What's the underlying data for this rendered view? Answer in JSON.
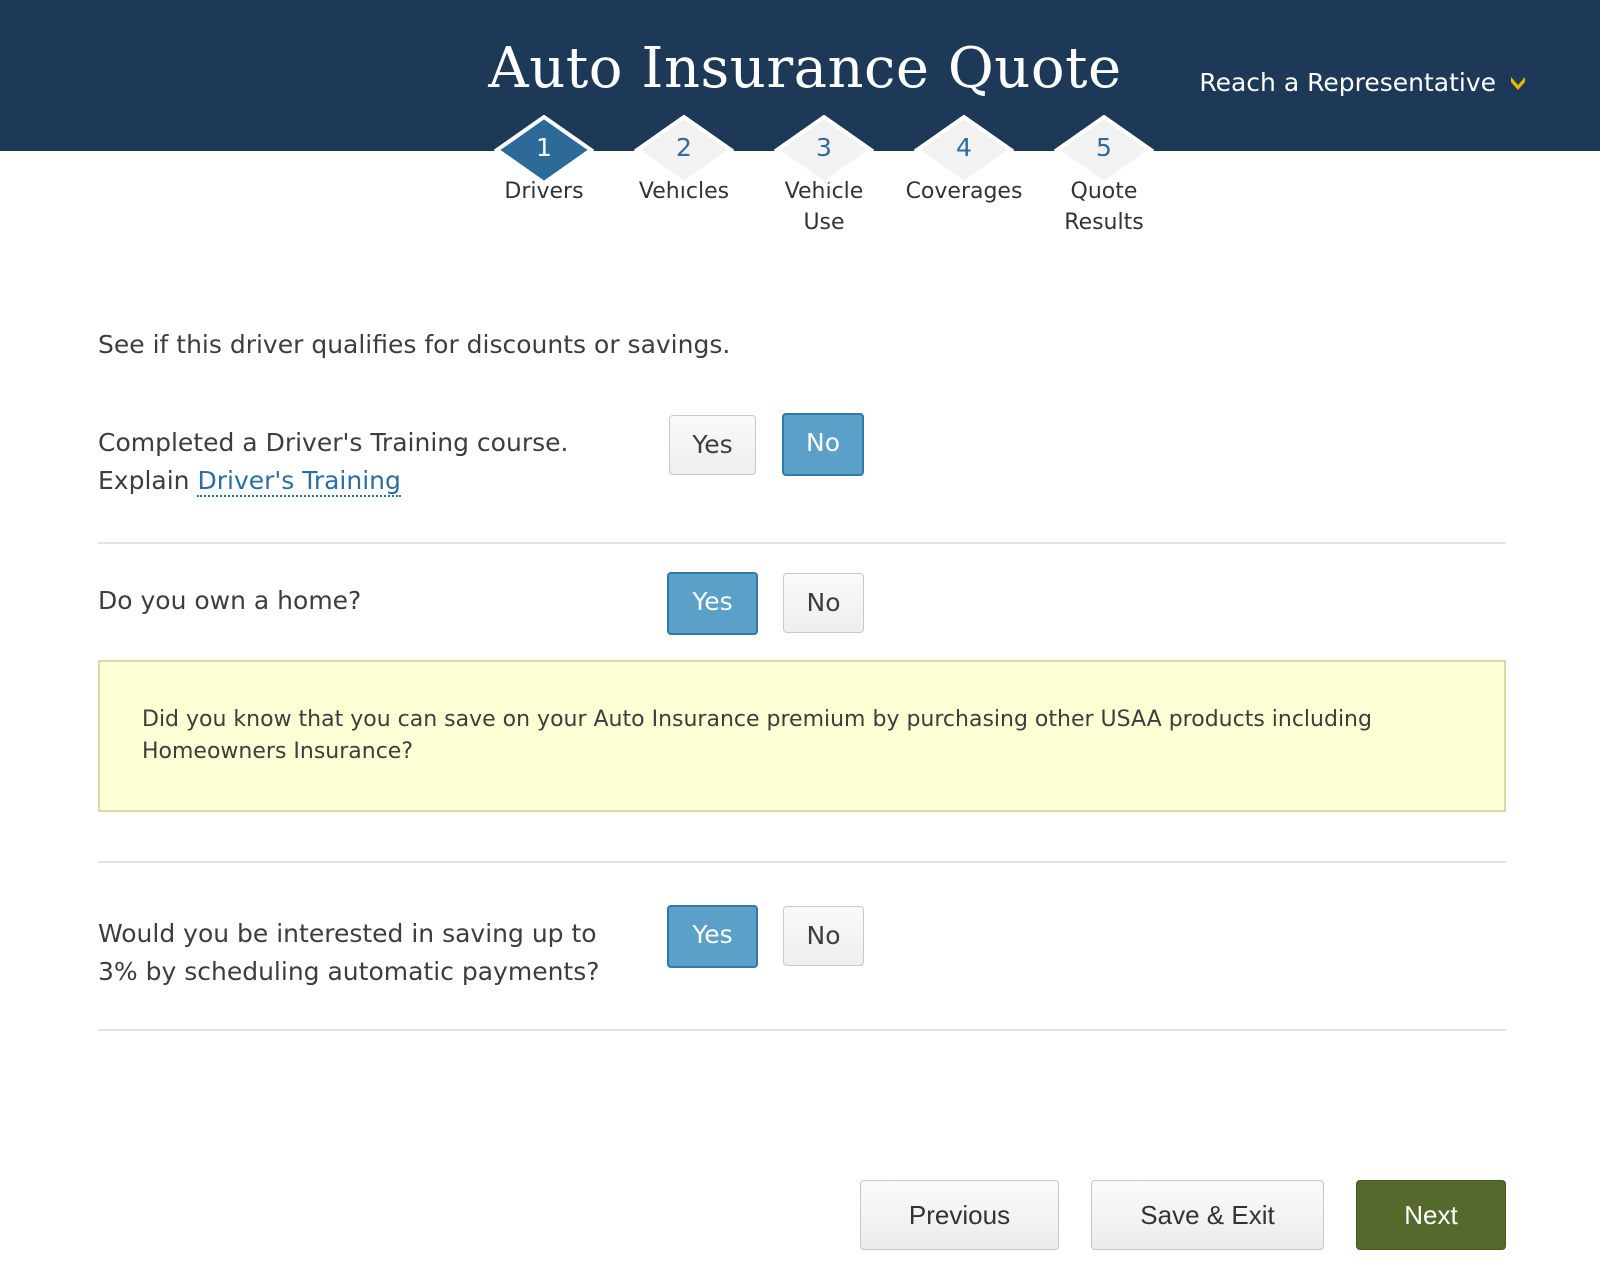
{
  "header": {
    "title": "Auto Insurance Quote",
    "rep_link": "Reach a Representative",
    "accent_color": "#e6b800",
    "bg_color": "#1e3957"
  },
  "steps": [
    {
      "num": "1",
      "line1": "Drivers",
      "line2": "",
      "active": true
    },
    {
      "num": "2",
      "line1": "Vehicles",
      "line2": "",
      "active": false
    },
    {
      "num": "3",
      "line1": "Vehicle",
      "line2": "Use",
      "active": false
    },
    {
      "num": "4",
      "line1": "Coverages",
      "line2": "",
      "active": false
    },
    {
      "num": "5",
      "line1": "Quote",
      "line2": "Results",
      "active": false
    }
  ],
  "intro": "See if this driver qualifies for discounts or savings.",
  "questions": {
    "training": {
      "line1": "Completed a Driver's Training course.",
      "explain_prefix": "Explain ",
      "explain_link": "Driver's Training",
      "selected": "No"
    },
    "home": {
      "text": "Do you own a home?",
      "selected": "Yes"
    },
    "autopay": {
      "line1": "Would you be interested in saving up to",
      "line2": "3% by scheduling automatic payments?",
      "selected": "Yes"
    }
  },
  "buttons": {
    "yes": "Yes",
    "no": "No"
  },
  "info_box": {
    "line1": "Did you know that you can save on your Auto Insurance premium by purchasing other USAA products including",
    "line2": "Homeowners Insurance?"
  },
  "footer": {
    "previous": "Previous",
    "save_exit": "Save & Exit",
    "next": "Next"
  }
}
